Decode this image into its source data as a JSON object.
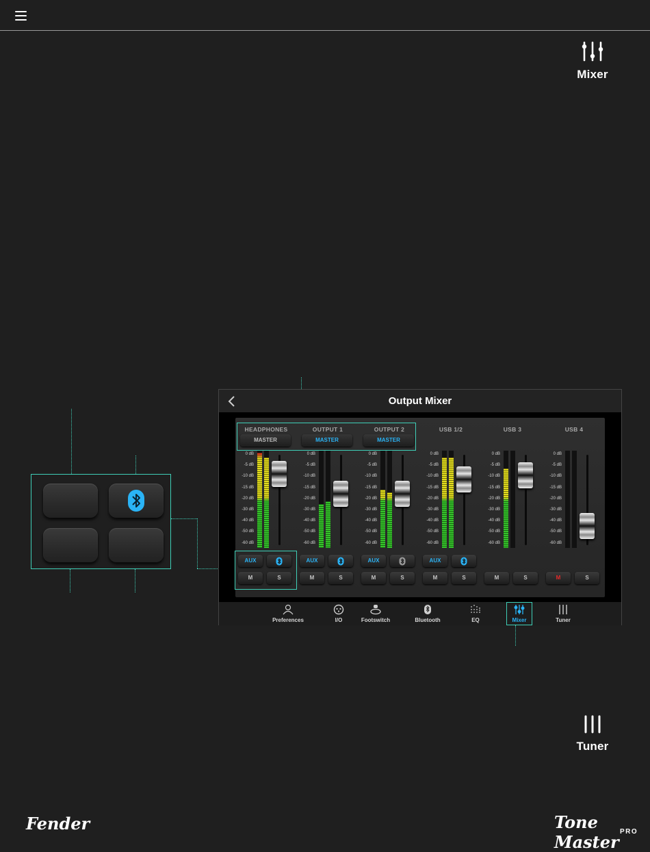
{
  "side_icons": {
    "mixer_label": "Mixer",
    "tuner_label": "Tuner"
  },
  "mixer_window": {
    "title": "Output Mixer",
    "db_scale": [
      "0 dB",
      "-5 dB",
      "-10 dB",
      "-15 dB",
      "-20 dB",
      "-30 dB",
      "-40 dB",
      "-50 dB",
      "-60 dB"
    ],
    "channels": [
      {
        "name": "HEADPHONES",
        "master_label": "MASTER",
        "master_active": false,
        "meter_levels": [
          0.98,
          0.93
        ],
        "fader_level": 0.9,
        "route_buttons": [
          "AUX",
          "bluetooth-icon"
        ],
        "route_active": [
          true,
          true
        ],
        "mute_label": "M",
        "solo_label": "S",
        "mute_active": false
      },
      {
        "name": "OUTPUT 1",
        "master_label": "MASTER",
        "master_active": true,
        "meter_levels": [
          0.45,
          0.48
        ],
        "fader_level": 0.6,
        "route_buttons": [
          "AUX",
          "bluetooth-icon"
        ],
        "route_active": [
          true,
          true
        ],
        "mute_label": "M",
        "solo_label": "S",
        "mute_active": false
      },
      {
        "name": "OUTPUT 2",
        "master_label": "MASTER",
        "master_active": true,
        "meter_levels": [
          0.6,
          0.57
        ],
        "fader_level": 0.6,
        "route_buttons": [
          "AUX",
          "bluetooth-icon"
        ],
        "route_active": [
          true,
          false
        ],
        "mute_label": "M",
        "solo_label": "S",
        "mute_active": false
      },
      {
        "name": "USB 1/2",
        "master_label": "",
        "master_active": false,
        "meter_levels": [
          0.93,
          0.93
        ],
        "fader_level": 0.82,
        "route_buttons": [
          "AUX",
          "bluetooth-icon"
        ],
        "route_active": [
          true,
          true
        ],
        "mute_label": "M",
        "solo_label": "S",
        "mute_active": false
      },
      {
        "name": "USB 3",
        "master_label": "",
        "master_active": false,
        "meter_levels": [
          0.82,
          0
        ],
        "fader_level": 0.88,
        "route_buttons": [],
        "route_active": [],
        "mute_label": "M",
        "solo_label": "S",
        "mute_active": false
      },
      {
        "name": "USB 4",
        "master_label": "",
        "master_active": false,
        "meter_levels": [
          0,
          0
        ],
        "fader_level": 0.1,
        "route_buttons": [],
        "route_active": [],
        "mute_label": "M",
        "solo_label": "S",
        "mute_active": true
      }
    ],
    "nav": [
      {
        "label": "Preferences",
        "icon": "person-icon",
        "active": false
      },
      {
        "label": "I/O",
        "icon": "xlr-icon",
        "active": false
      },
      {
        "label": "Footswitch",
        "icon": "footswitch-icon",
        "active": false
      },
      {
        "label": "Bluetooth",
        "icon": "bluetooth-icon",
        "active": false
      },
      {
        "label": "EQ",
        "icon": "eq-dots-icon",
        "active": false
      },
      {
        "label": "Mixer",
        "icon": "sliders-icon",
        "active": true
      },
      {
        "label": "Tuner",
        "icon": "tuner-bars-icon",
        "active": false
      }
    ]
  },
  "zoom_buttons": [
    "",
    "bluetooth-icon",
    "",
    ""
  ],
  "logos": {
    "left": "Fender",
    "right": "Tone Master",
    "right_sub": "PRO"
  },
  "colors": {
    "accent_blue": "#2ab3f5",
    "callout_teal": "#3fd0b8",
    "mute_red": "#e42a2a",
    "meter_green": "#35c42a",
    "meter_yellow": "#e4de1d"
  }
}
